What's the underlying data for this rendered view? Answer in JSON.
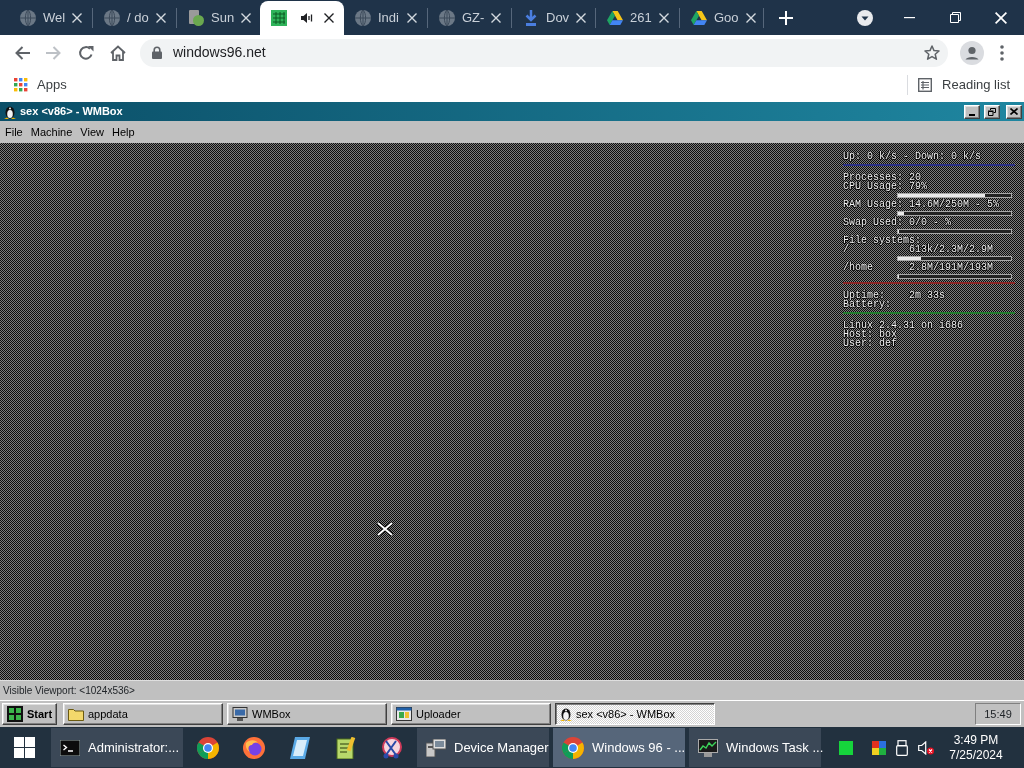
{
  "browser_tabs": [
    {
      "kind": "globe",
      "title": "Wel",
      "selected": false,
      "audio": false
    },
    {
      "kind": "globe",
      "title": "/ do",
      "selected": false,
      "audio": false
    },
    {
      "kind": "app",
      "title": "Sun",
      "selected": false,
      "audio": false
    },
    {
      "kind": "chip",
      "selected": true,
      "audio": true
    },
    {
      "kind": "globe",
      "title": "Indi",
      "selected": false,
      "audio": false
    },
    {
      "kind": "globe",
      "title": "GZ-",
      "selected": false,
      "audio": false
    },
    {
      "kind": "download",
      "title": "Dov",
      "selected": false,
      "audio": false
    },
    {
      "kind": "drive",
      "title": "261",
      "selected": false,
      "audio": false
    },
    {
      "kind": "drive",
      "title": "Goo",
      "selected": false,
      "audio": false
    }
  ],
  "nav_buttons": [
    {
      "kind": "back",
      "disabled": false
    },
    {
      "kind": "forward",
      "disabled": true
    },
    {
      "kind": "reload",
      "disabled": false
    },
    {
      "kind": "home",
      "disabled": false
    }
  ],
  "address_bar": {
    "url": "windows96.net"
  },
  "bookmarks_bar": {
    "apps": "Apps",
    "reading_list": "Reading list"
  },
  "wmbox": {
    "title": "sex <v86> - WMBox",
    "menu": [
      "File",
      "Machine",
      "View",
      "Help"
    ],
    "screen_lines": [
      {
        "kind": "text",
        "text": "Up: 0 k/s - Down: 0 k/s"
      },
      {
        "kind": "rule",
        "color": "#2a2f86"
      },
      {
        "kind": "pair",
        "label": "Processes:",
        "value": "20"
      },
      {
        "kind": "pair",
        "label": "CPU Usage:",
        "value": "79%"
      },
      {
        "kind": "bar",
        "level": 0.77
      },
      {
        "kind": "pair",
        "label": "RAM Usage:",
        "value": "14.6M/250M - 5%"
      },
      {
        "kind": "bar",
        "level": 0.05
      },
      {
        "kind": "pair",
        "label": "Swap Used:",
        "value": "0/0 - %"
      },
      {
        "kind": "bar",
        "level": 0
      },
      {
        "kind": "text",
        "text": "File systems:"
      },
      {
        "kind": "pair",
        "label": "/",
        "value": "613k/2.3M/2.9M"
      },
      {
        "kind": "bar",
        "level": 0.2
      },
      {
        "kind": "pair",
        "label": "/home",
        "value": "2.8M/191M/193M"
      },
      {
        "kind": "bar",
        "level": 0.01
      },
      {
        "kind": "rule",
        "color": "#8a2424"
      },
      {
        "kind": "pair",
        "label": "Uptime:",
        "value": "2m 33s"
      },
      {
        "kind": "text",
        "text": "Battery:"
      },
      {
        "kind": "rule",
        "color": "#227a2e"
      },
      {
        "kind": "text",
        "text": "Linux 2.4.31 on i686"
      },
      {
        "kind": "text",
        "text": "Host: box"
      },
      {
        "kind": "text",
        "text": "User: def"
      }
    ],
    "status": "Visible Viewport: <1024x536>"
  },
  "guest_taskbar": {
    "start": "Start",
    "tasks": [
      {
        "kind": "folder",
        "label": "appdata",
        "selected": false
      },
      {
        "kind": "monitor",
        "label": "WMBox",
        "selected": false
      },
      {
        "kind": "window",
        "label": "Uploader",
        "selected": false
      },
      {
        "kind": "penguin",
        "label": "sex <v86> - WMBox",
        "selected": true
      }
    ],
    "clock": "15:49"
  },
  "host_taskbar": {
    "items": [
      {
        "kind": "terminal",
        "label": "Administrator:...",
        "active": false
      },
      {
        "kind": "browser",
        "active": false
      },
      {
        "kind": "flame",
        "active": false
      },
      {
        "kind": "notebook",
        "active": false
      },
      {
        "kind": "notepad",
        "active": false
      },
      {
        "kind": "scissors",
        "active": false
      },
      {
        "kind": "computer",
        "label": "Device Manager",
        "active": false
      },
      {
        "kind": "browser",
        "label": "Windows 96 - ...",
        "active": true
      },
      {
        "kind": "graph",
        "label": "Windows Task ...",
        "active": false
      },
      {
        "kind": "square",
        "active": false
      }
    ],
    "time": "3:49 PM",
    "date": "7/25/2024"
  }
}
